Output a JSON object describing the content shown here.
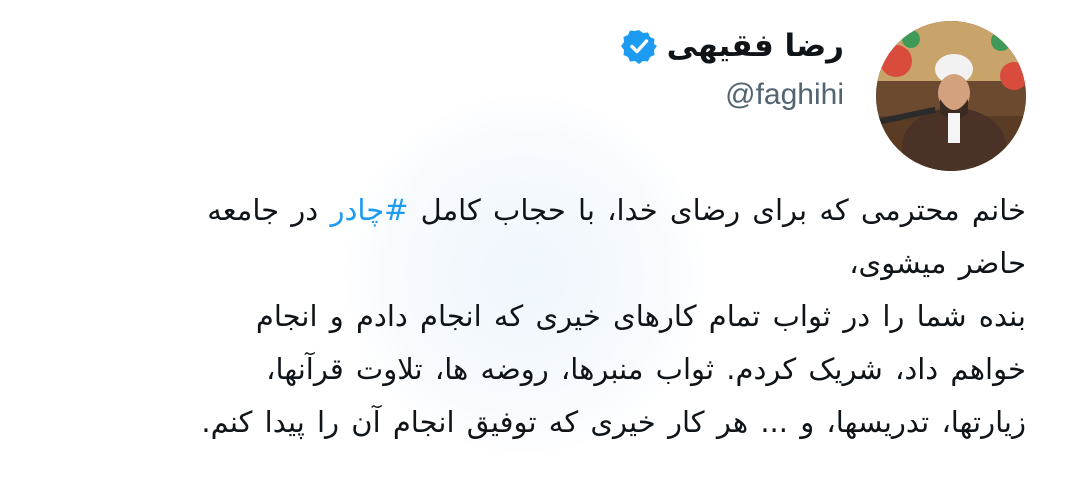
{
  "author": {
    "display_name": "رضا فقیهی",
    "handle": "@faghihi",
    "verified_icon": "verified-badge-icon",
    "avatar": "avatar-photo"
  },
  "tweet": {
    "line1_prefix": "خانم محترمی که برای رضای خدا، با حجاب کامل ",
    "hashtag": "#چادر",
    "line1_suffix": " در جامعه",
    "line2": "حاضر میشوی،",
    "line3": "بنده شما را در ثواب تمام کارهای خیری که انجام دادم و انجام",
    "line4": "خواهم داد، شریک کردم. ثواب منبرها، روضه ها، تلاوت قرآنها،",
    "line5": "زیارتها، تدریسها، و ... هر کار خیری که توفیق انجام آن را پیدا کنم."
  },
  "colors": {
    "text": "#0f1419",
    "secondary": "#536471",
    "accent": "#1d9bf0",
    "background": "#ffffff"
  }
}
